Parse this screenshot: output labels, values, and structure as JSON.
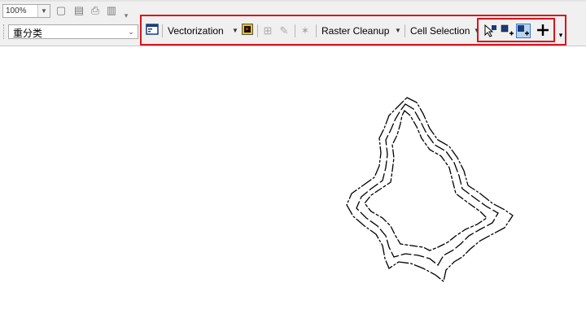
{
  "top_toolbar": {
    "zoom_value": "100%"
  },
  "layer_selector": {
    "value": "重分类"
  },
  "raster_toolbar": {
    "vectorization_label": "Vectorization",
    "raster_cleanup_label": "Raster Cleanup",
    "cell_selection_label": "Cell Selection",
    "highlight_color": "#d8141c"
  }
}
